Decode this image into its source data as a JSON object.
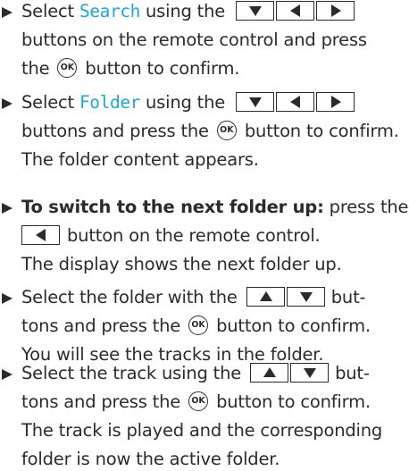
{
  "steps": [
    {
      "lines": [
        [
          "Select ",
          "Search",
          " using the",
          "buttons on the remote control and press",
          "the",
          "button to confirm."
        ]
      ]
    },
    {
      "t1a": "Select ",
      "t1h": "Folder",
      "t1b": " using the"
    },
    {}
  ],
  "step1": {
    "l1_pre": "Select ",
    "l1_hl": "Search",
    "l1_post": " using the",
    "l2": "buttons on the remote control and press",
    "l3_pre": "the",
    "l3_post": "button to confirm."
  },
  "step2": {
    "l1_pre": "Select ",
    "l1_hl": "Folder",
    "l1_post": " using the",
    "l2_pre": "buttons and press the",
    "l2_post": "button to confirm.",
    "l3": "The folder content appears."
  },
  "step3": {
    "l1_bold": "To switch to the next folder up:",
    "l1_post": " press the",
    "l2_post": "button on the remote control.",
    "l3": "The display shows the next folder up."
  },
  "step4": {
    "l1_pre": "Select the folder with the",
    "l1_post": "but-",
    "l2_pre": "tons and press the",
    "l2_post": "button to confirm.",
    "l3": "You will see the tracks in the folder."
  },
  "step5": {
    "l1_pre": "Select the track using the",
    "l1_post": "but-",
    "l2_pre": "tons and press the",
    "l2_post": "button to confirm.",
    "l3": "The track is played and the corresponding",
    "l4": "folder is now the active folder."
  },
  "ok_label": "OK",
  "colors": {
    "highlight": "#1ea6d8",
    "text": "#2b2b2b"
  },
  "icons": [
    "bullet-arrow-icon",
    "arrow-down-key-icon",
    "arrow-left-key-icon",
    "arrow-right-key-icon",
    "arrow-up-key-icon",
    "ok-button-icon"
  ]
}
